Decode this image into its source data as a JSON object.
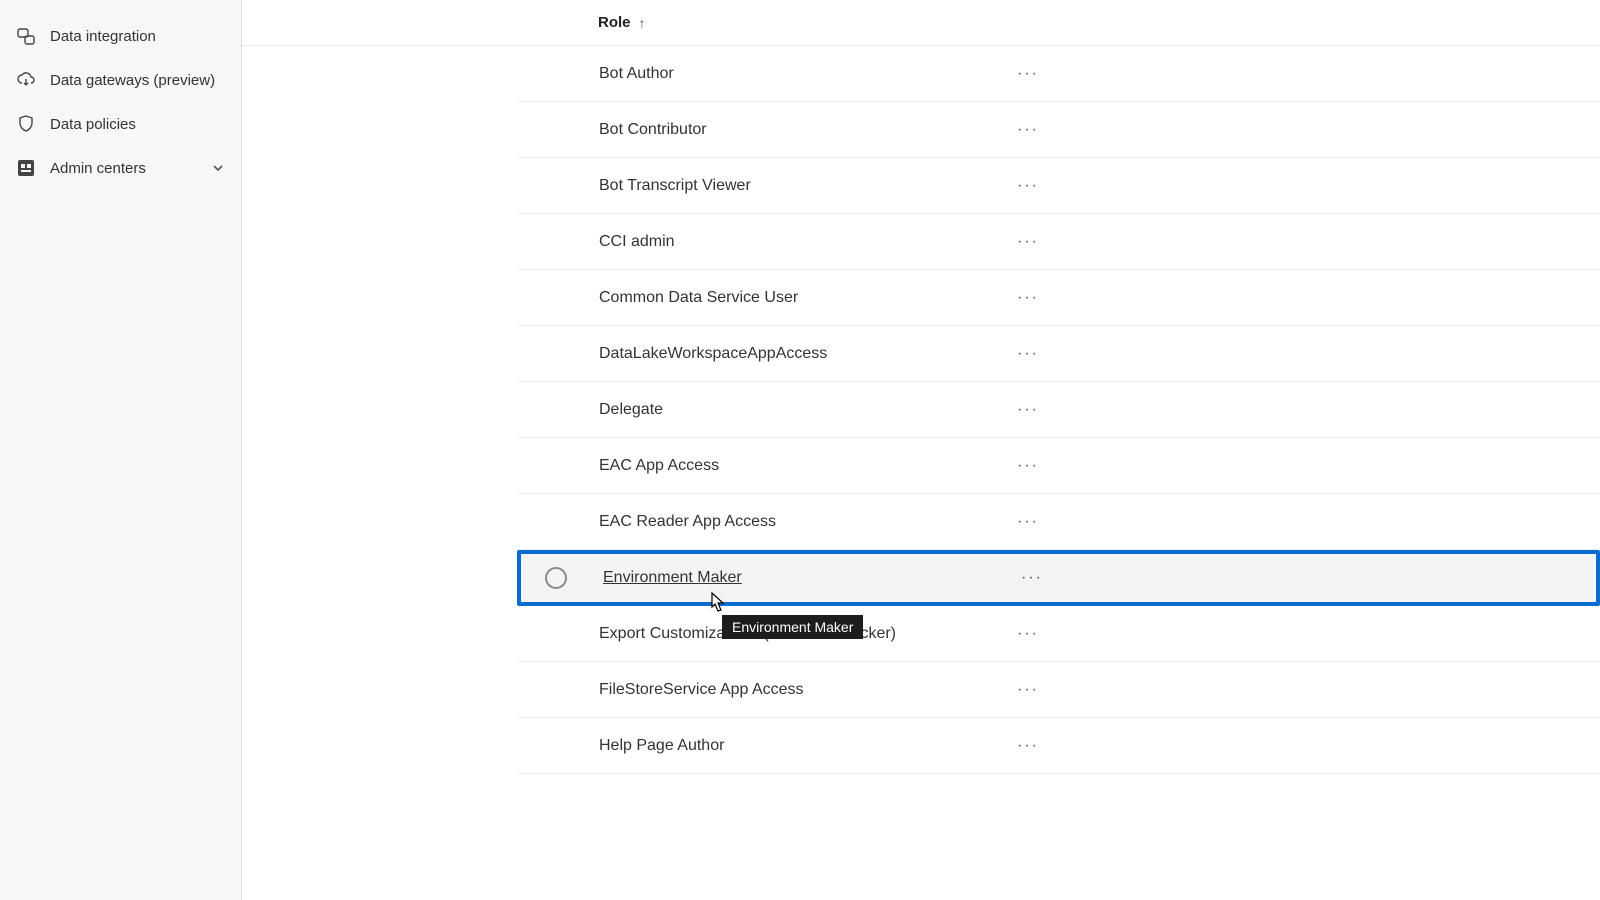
{
  "sidebar": {
    "items": [
      {
        "label": "Data integration"
      },
      {
        "label": "Data gateways (preview)"
      },
      {
        "label": "Data policies"
      },
      {
        "label": "Admin centers"
      }
    ]
  },
  "table": {
    "header": "Role",
    "rows": [
      {
        "name": "Bot Author"
      },
      {
        "name": "Bot Contributor"
      },
      {
        "name": "Bot Transcript Viewer"
      },
      {
        "name": "CCI admin"
      },
      {
        "name": "Common Data Service User"
      },
      {
        "name": "DataLakeWorkspaceAppAccess"
      },
      {
        "name": "Delegate"
      },
      {
        "name": "EAC App Access"
      },
      {
        "name": "EAC Reader App Access"
      },
      {
        "name": "Environment Maker",
        "highlighted": true
      },
      {
        "name": "Export Customizations (Solution Checker)"
      },
      {
        "name": "FileStoreService App Access"
      },
      {
        "name": "Help Page Author"
      }
    ]
  },
  "tooltip": "Environment Maker"
}
